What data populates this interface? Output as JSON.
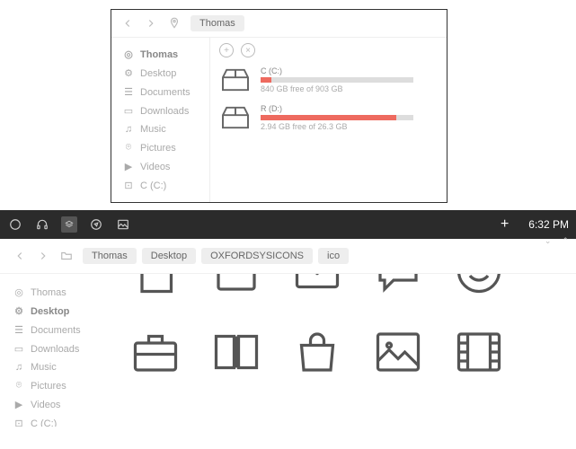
{
  "panel1": {
    "breadcrumb": [
      "Thomas"
    ],
    "sidebar": [
      {
        "icon": "pin",
        "label": "Thomas",
        "active": true
      },
      {
        "icon": "gear",
        "label": "Desktop"
      },
      {
        "icon": "stack",
        "label": "Documents"
      },
      {
        "icon": "folder",
        "label": "Downloads"
      },
      {
        "icon": "music",
        "label": "Music"
      },
      {
        "icon": "camera",
        "label": "Pictures"
      },
      {
        "icon": "video",
        "label": "Videos"
      },
      {
        "icon": "drive",
        "label": "C (C:)"
      }
    ],
    "drives": [
      {
        "name": "C (C:)",
        "free": "840 GB free of 903 GB",
        "fill_pct": 7
      },
      {
        "name": "R (D:)",
        "free": "2.94 GB free of 26.3 GB",
        "fill_pct": 89
      }
    ]
  },
  "panel2": {
    "time": "6:32 PM",
    "breadcrumb": [
      "Thomas",
      "Desktop",
      "OXFORDSYSICONS",
      "ico"
    ],
    "sidebar": [
      {
        "icon": "pin",
        "label": "Thomas"
      },
      {
        "icon": "gear",
        "label": "Desktop",
        "active": true
      },
      {
        "icon": "stack",
        "label": "Documents"
      },
      {
        "icon": "folder",
        "label": "Downloads"
      },
      {
        "icon": "music",
        "label": "Music"
      },
      {
        "icon": "camera",
        "label": "Pictures"
      },
      {
        "icon": "video",
        "label": "Videos"
      },
      {
        "icon": "drive",
        "label": "C (C:)"
      }
    ],
    "icons_row1": [
      "doc",
      "square",
      "mail",
      "chat",
      "smile",
      "blank"
    ],
    "icons_row2": [
      "briefcase",
      "book",
      "bag",
      "image",
      "film"
    ]
  }
}
